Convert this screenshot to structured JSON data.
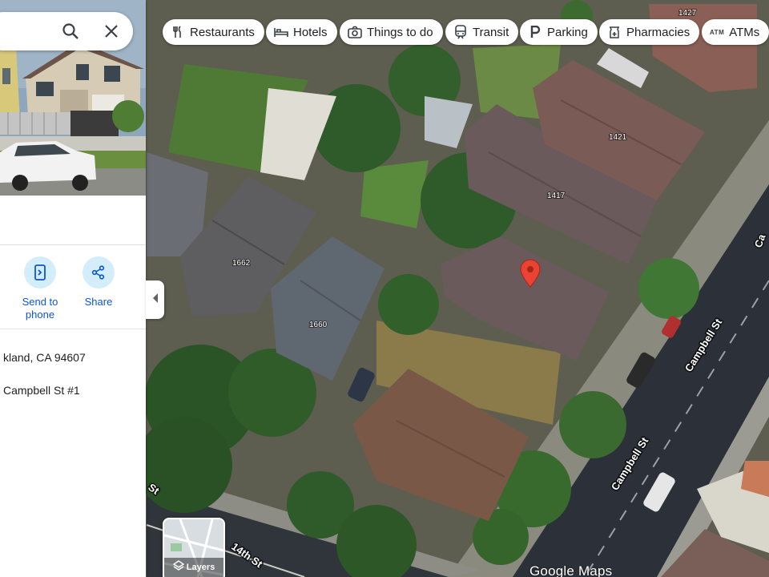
{
  "search": {
    "placeholder": ""
  },
  "panel": {
    "actions": [
      {
        "label": "Send to phone",
        "icon": "send-to-phone-icon"
      },
      {
        "label": "Share",
        "icon": "share-icon"
      }
    ],
    "address_line": "kland, CA 94607",
    "unit_line": "Campbell St #1"
  },
  "chips": [
    {
      "label": "Restaurants",
      "icon": "fork-knife-icon"
    },
    {
      "label": "Hotels",
      "icon": "bed-icon"
    },
    {
      "label": "Things to do",
      "icon": "camera-icon"
    },
    {
      "label": "Transit",
      "icon": "train-icon"
    },
    {
      "label": "Parking",
      "icon": "parking-icon"
    },
    {
      "label": "Pharmacies",
      "icon": "pharmacy-icon"
    },
    {
      "label": "ATMs",
      "icon": "atm-icon",
      "icon_text": "ATM"
    }
  ],
  "map": {
    "lot_numbers": [
      "1427",
      "1421",
      "1417",
      "1662",
      "1660"
    ],
    "streets": [
      "Campbell St",
      "Campbell St",
      "14th St",
      "St",
      "Ca"
    ],
    "layers_label": "Layers",
    "watermark": "Google Maps"
  },
  "colors": {
    "accent": "#0b57d0",
    "action_circle": "#d3eefa",
    "pin": "#ea4335",
    "chip_bg": "#ffffff"
  }
}
